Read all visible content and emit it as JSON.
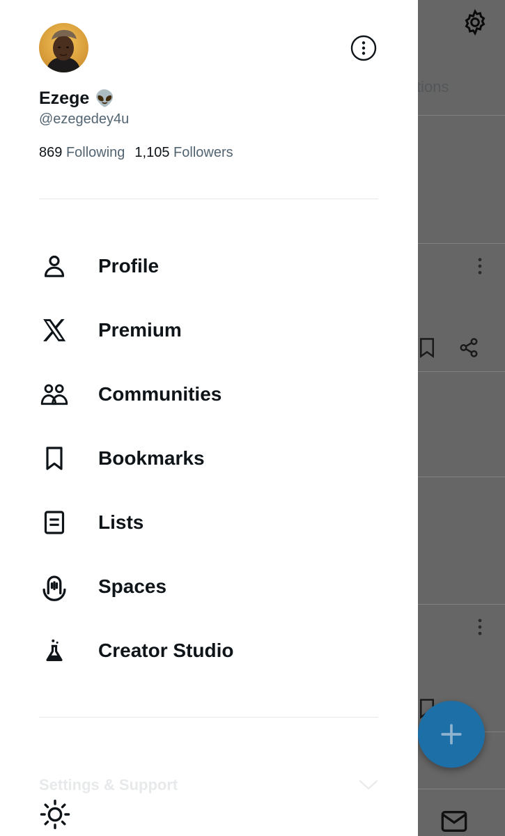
{
  "profile": {
    "name": "Ezege",
    "emoji": "👽",
    "handle": "@ezegedey4u",
    "following_count": "869",
    "following_label": "Following",
    "followers_count": "1,105",
    "followers_label": "Followers"
  },
  "menu": {
    "items": [
      {
        "label": "Profile",
        "icon": "person-icon"
      },
      {
        "label": "Premium",
        "icon": "x-logo-icon"
      },
      {
        "label": "Communities",
        "icon": "communities-icon"
      },
      {
        "label": "Bookmarks",
        "icon": "bookmark-icon"
      },
      {
        "label": "Lists",
        "icon": "list-icon"
      },
      {
        "label": "Spaces",
        "icon": "spaces-icon"
      },
      {
        "label": "Creator Studio",
        "icon": "flask-icon"
      }
    ]
  },
  "settings": {
    "label": "Settings & Support"
  },
  "background": {
    "tab_fragment": "tions"
  },
  "colors": {
    "text_primary": "#0f1419",
    "text_secondary": "#536471",
    "fab": "#1d6fa8"
  }
}
